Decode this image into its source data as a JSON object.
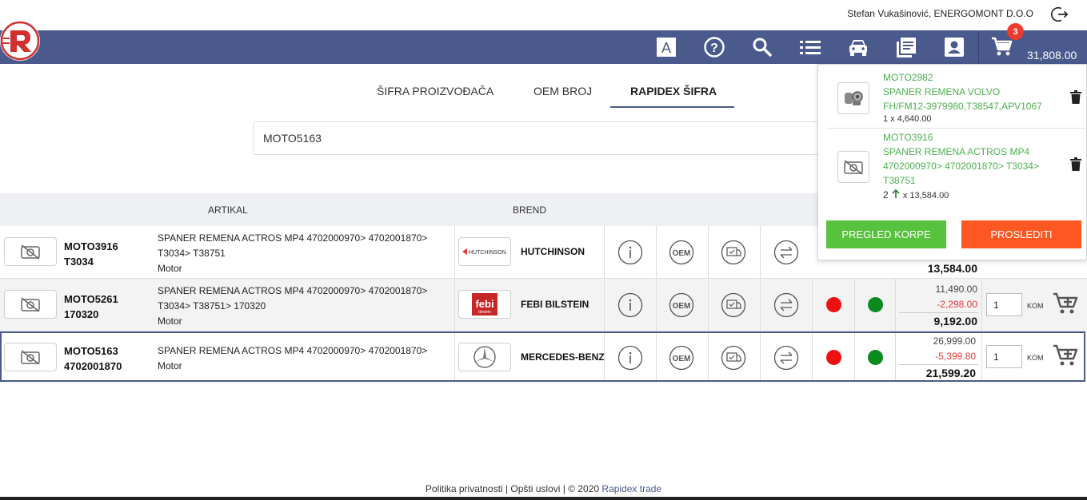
{
  "header": {
    "user": "Stefan Vukašinović, ENERGOMONT D.O.O",
    "cart_count": "3",
    "cart_total": "31,808.00",
    "nav_icons": [
      "letter-a-icon",
      "help-icon",
      "search-icon",
      "list-icon",
      "car-icon",
      "catalog-icon",
      "account-icon",
      "cart-icon"
    ]
  },
  "tabs": [
    {
      "label": "ŠIFRA PROIZVOĐAČA"
    },
    {
      "label": "OEM BROJ"
    },
    {
      "label": "RAPIDEX ŠIFRA"
    }
  ],
  "search": {
    "value": "MOTO5163"
  },
  "table": {
    "headers": {
      "article": "ARTIKAL",
      "brand": "BREND"
    },
    "rows": [
      {
        "code1": "MOTO3916",
        "code2": "T3034",
        "desc": "SPANER REMENA ACTROS MP4 4702000970> 4702001870> T3034> T38751",
        "category": "Motor",
        "brand": "HUTCHINSON",
        "price_final": "13,584.00"
      },
      {
        "code1": "MOTO5261",
        "code2": "170320",
        "desc": "SPANER REMENA ACTROS MP4 4702000970> 4702001870> T3034> T38751> 170320",
        "category": "Motor",
        "brand": "FEBI BILSTEIN",
        "price_old": "11,490.00",
        "price_discount": "-2,298.00",
        "price_final": "9,192.00",
        "qty": "1",
        "unit": "KOM"
      },
      {
        "code1": "MOTO5163",
        "code2": "4702001870",
        "desc": "SPANER REMENA ACTROS MP4 4702000970> 4702001870>",
        "category": "Motor",
        "brand": "MERCEDES-BENZ",
        "price_old": "26,999.00",
        "price_discount": "-5,399.80",
        "price_final": "21,599.20",
        "qty": "1",
        "unit": "KOM"
      }
    ]
  },
  "cart_panel": {
    "items": [
      {
        "code": "MOTO2982",
        "name": "SPANER REMENA VOLVO FH/FM12-3979980,T38547,APV1067",
        "qty_line": "1 x 4,640.00"
      },
      {
        "code": "MOTO3916",
        "name": "SPANER REMENA ACTROS MP4 4702000970> 4702001870> T3034> T38751",
        "qty": "2",
        "qty_line": "x 13,584.00"
      }
    ],
    "review_label": "PREGLED KORPE",
    "send_label": "PROSLEDITI"
  },
  "footer": {
    "privacy": "Politika privatnosti",
    "sep1": " | ",
    "terms": "Opšti uslovi",
    "sep2": " | © 2020 ",
    "company": "Rapidex trade"
  },
  "colors": {
    "nav": "#4a5a8c",
    "green": "#56c23d",
    "orange": "#ff5722",
    "badge": "#ef3b2d"
  }
}
